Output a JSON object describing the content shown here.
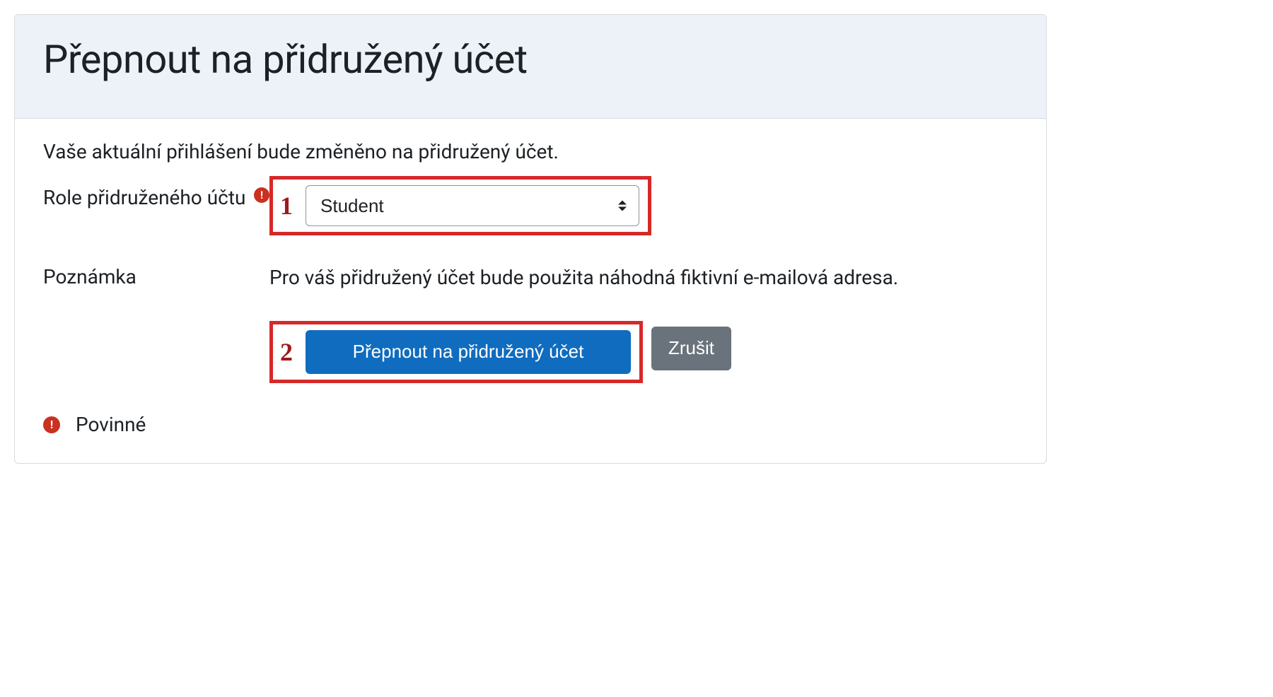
{
  "header": {
    "title": "Přepnout na přidružený účet"
  },
  "intro": "Vaše aktuální přihlášení bude změněno na přidružený účet.",
  "form": {
    "role": {
      "label": "Role přidruženého účtu",
      "selected": "Student"
    },
    "note": {
      "label": "Poznámka",
      "text": "Pro váš přidružený účet bude použita náhodná fiktivní e-mailová adresa."
    }
  },
  "annotations": {
    "step1": "1",
    "step2": "2"
  },
  "buttons": {
    "submit": "Přepnout na přidružený účet",
    "cancel": "Zrušit"
  },
  "legend": {
    "required_mark": "!",
    "required_label": "Povinné"
  }
}
